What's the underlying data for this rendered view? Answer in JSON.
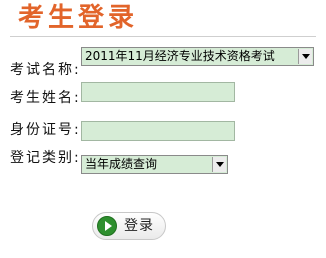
{
  "page": {
    "title": "考生登录"
  },
  "form": {
    "exam_name_label": "考试名称:",
    "exam_name_value": "2011年11月经济专业技术资格考试",
    "candidate_name_label": "考生姓名:",
    "candidate_name_value": "",
    "id_number_label": "身份证号:",
    "id_number_value": "",
    "registration_type_label": "登记类别:",
    "registration_type_value": "当年成绩查询"
  },
  "actions": {
    "login_label": "登录"
  },
  "icons": {
    "login": "play-arrow-icon",
    "dropdown": "chevron-down-icon"
  },
  "colors": {
    "title": "#e2642a",
    "field_bg": "#d6ecd6",
    "login_icon": "#2e8f2e"
  }
}
